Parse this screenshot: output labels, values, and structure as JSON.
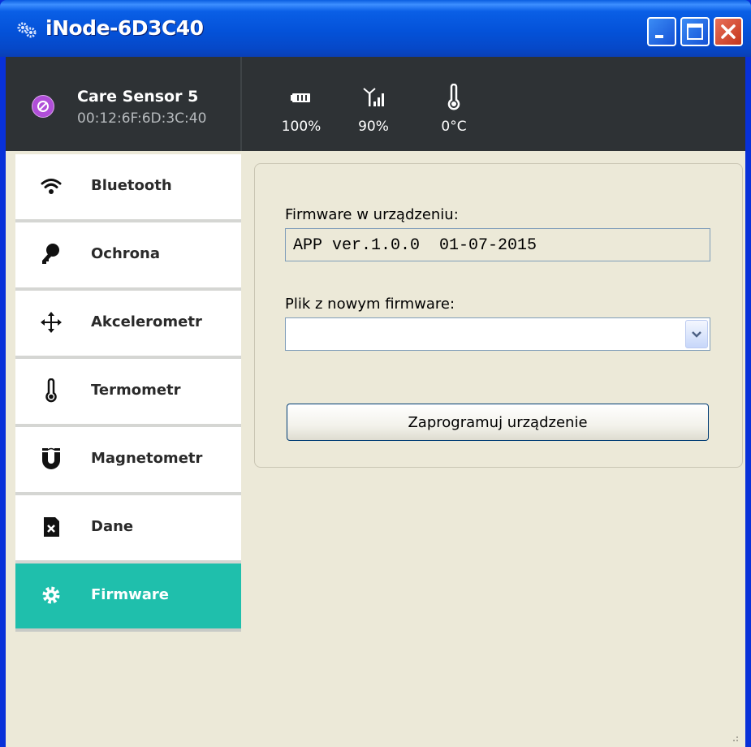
{
  "window": {
    "title": "iNode-6D3C40",
    "controls": [
      "minimize",
      "maximize",
      "close"
    ]
  },
  "device": {
    "name": "Care Sensor 5",
    "mac": "00:12:6F:6D:3C:40",
    "icon": "device-circle-icon"
  },
  "status": {
    "battery": {
      "icon": "battery-icon",
      "value": "100%"
    },
    "signal": {
      "icon": "signal-icon",
      "value": "90%"
    },
    "temperature": {
      "icon": "thermometer-icon",
      "value": "0°C"
    }
  },
  "sidebar": {
    "active_index": 6,
    "items": [
      {
        "label": "Bluetooth",
        "icon": "wifi-icon"
      },
      {
        "label": "Ochrona",
        "icon": "key-icon"
      },
      {
        "label": "Akcelerometr",
        "icon": "move-arrows-icon"
      },
      {
        "label": "Termometr",
        "icon": "thermometer-icon"
      },
      {
        "label": "Magnetometr",
        "icon": "magnet-icon"
      },
      {
        "label": "Dane",
        "icon": "sd-card-icon"
      },
      {
        "label": "Firmware",
        "icon": "gear-icon"
      }
    ]
  },
  "firmware": {
    "current_label": "Firmware w urządzeniu:",
    "current_value": "APP ver.1.0.0  01-07-2015",
    "new_file_label": "Plik z nowym firmware:",
    "new_file_value": "",
    "program_button": "Zaprogramuj urządzenie"
  },
  "colors": {
    "titlebar": "#0452d9",
    "header": "#2e3235",
    "accent": "#1fbfac",
    "device": "#b04ed8"
  }
}
